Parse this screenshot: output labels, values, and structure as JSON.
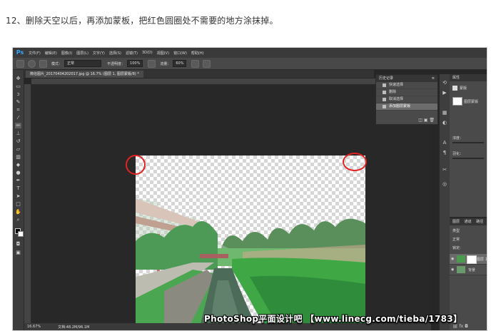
{
  "caption": "12、删除天空以后，再添加蒙板，把红色圆圈处不需要的地方涂抹掉。",
  "app": {
    "logo": "Ps",
    "menu": [
      "文件(F)",
      "编辑(E)",
      "图像(I)",
      "图层(L)",
      "文字(Y)",
      "选择(S)",
      "滤镜(T)",
      "3D(D)",
      "视图(V)",
      "窗口(W)",
      "帮助(H)"
    ]
  },
  "options": {
    "mode_label": "模式：",
    "mode_value": "正常",
    "opacity_label": "不透明度：",
    "opacity_value": "100%",
    "flow_label": "流量：",
    "flow_value": "60%"
  },
  "document": {
    "tab_title": "微信图片_20170404202017.jpg @ 16.7% (图层 1, 图层蒙版/8) *",
    "zoom": "16.67%",
    "file_info": "文档:48.2M/96.1M"
  },
  "history": {
    "title": "历史记录",
    "items": [
      {
        "label": "快速选择",
        "selected": false
      },
      {
        "label": "删除",
        "selected": false
      },
      {
        "label": "取消选择",
        "selected": false
      },
      {
        "label": "添加图层蒙版",
        "selected": true
      }
    ]
  },
  "properties": {
    "title": "属性",
    "mask_label": "蒙版",
    "layer_mask": "图层蒙版",
    "density_label": "浓度：",
    "feather_label": "羽化："
  },
  "layers": {
    "tabs": [
      "图层",
      "通道",
      "路径"
    ],
    "kind_label": "类型",
    "blend_mode": "正常",
    "lock_label": "锁定:",
    "rows": [
      {
        "name": "图层 1"
      },
      {
        "name": "背景"
      }
    ]
  },
  "watermark": "PhotoShop平面设计吧 【www.linecg.com/tieba/1783】",
  "colors": {
    "accent_ps": "#31a8ff",
    "annotation_red": "#e32222",
    "foliage": "#3fa845",
    "water": "#4c6b58"
  },
  "icons": [
    "move-icon",
    "marquee-icon",
    "lasso-icon",
    "quick-selection-icon",
    "crop-icon",
    "eyedropper-icon",
    "brush-icon",
    "stamp-icon",
    "history-brush-icon",
    "eraser-icon",
    "gradient-icon",
    "blur-icon",
    "dodge-icon",
    "pen-icon",
    "type-icon",
    "path-icon",
    "rectangle-icon",
    "hand-icon",
    "zoom-icon"
  ]
}
